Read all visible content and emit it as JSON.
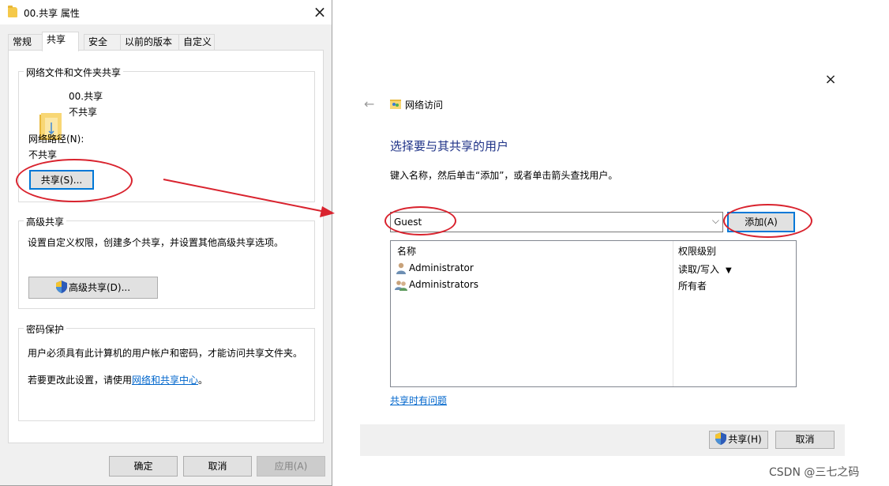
{
  "properties_dialog": {
    "title": "00.共享 属性",
    "tabs": [
      "常规",
      "共享",
      "安全",
      "以前的版本",
      "自定义"
    ],
    "active_tab": "共享",
    "network_group": {
      "label": "网络文件和文件夹共享",
      "folder_name": "00.共享",
      "folder_status": "不共享",
      "path_label": "网络路径(N):",
      "path_value": "不共享",
      "share_button": "共享(S)..."
    },
    "advanced_group": {
      "label": "高级共享",
      "description": "设置自定义权限，创建多个共享，并设置其他高级共享选项。",
      "button": "高级共享(D)..."
    },
    "password_group": {
      "label": "密码保护",
      "description": "用户必须具有此计算机的用户帐户和密码，才能访问共享文件夹。",
      "change_prefix": "若要更改此设置，请使用",
      "change_link": "网络和共享中心",
      "change_suffix": "。"
    },
    "buttons": {
      "ok": "确定",
      "cancel": "取消",
      "apply": "应用(A)"
    }
  },
  "network_access": {
    "close_glyph": "×",
    "back_glyph": "←",
    "window_title": "网络访问",
    "heading": "选择要与其共享的用户",
    "instruction": "键入名称，然后单击“添加”，或者单击箭头查找用户。",
    "user_input_value": "Guest",
    "add_button": "添加(A)",
    "columns": {
      "name": "名称",
      "permission": "权限级别"
    },
    "users": [
      {
        "name": "Administrator",
        "permission": "读取/写入",
        "has_dropdown": true,
        "icon": "user-icon"
      },
      {
        "name": "Administrators",
        "permission": "所有者",
        "has_dropdown": false,
        "icon": "group-icon"
      }
    ],
    "help_link": "共享时有问题",
    "share_button": "共享(H)",
    "cancel_button": "取消"
  },
  "annotations": {
    "ring_color": "#d9232e",
    "arrow_color": "#d9232e"
  },
  "watermark": "CSDN @三七之码"
}
